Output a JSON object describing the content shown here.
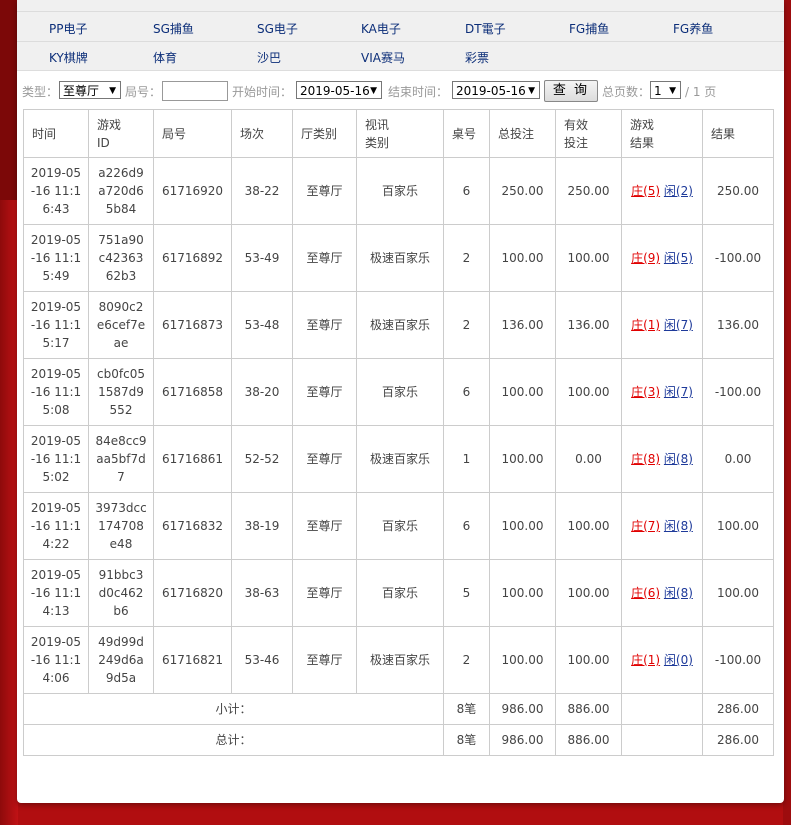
{
  "nav": {
    "row1": [
      "PP电子",
      "SG捕鱼",
      "SG电子",
      "KA电子",
      "DT電子",
      "FG捕鱼",
      "FG养鱼"
    ],
    "row2": [
      "KY棋牌",
      "体育",
      "沙巴",
      "VIA赛马",
      "彩票"
    ]
  },
  "filters": {
    "type_label": "类型：",
    "type_value": "至尊厅",
    "round_label": "局号：",
    "round_value": "",
    "start_label": "开始时间：",
    "start_value": "2019-05-16",
    "end_label": "结束时间：",
    "end_value": "2019-05-16",
    "query_button": "查 询",
    "pages_label": "总页数：",
    "page_value": "1",
    "page_total": "/ 1 页"
  },
  "table": {
    "headers": {
      "time": "时间",
      "game_id": "游戏ID",
      "round": "局号",
      "session": "场次",
      "hall_type": "厅类别",
      "video_type": "视讯类别",
      "table_no": "桌号",
      "total_bet": "总投注",
      "valid_bet": "有效投注",
      "game_result": "游戏结果",
      "result": "结果"
    },
    "rows": [
      {
        "time": "2019-05-16 11:16:43",
        "game_id": "a226d9a720d65b84",
        "round": "61716920",
        "session": "38-22",
        "hall": "至尊厅",
        "video": "百家乐",
        "table": "6",
        "total": "250.00",
        "valid": "250.00",
        "bank": "庄(5)",
        "player": "闲(2)",
        "result": "250.00"
      },
      {
        "time": "2019-05-16 11:15:49",
        "game_id": "751a90c4236362b3",
        "round": "61716892",
        "session": "53-49",
        "hall": "至尊厅",
        "video": "极速百家乐",
        "table": "2",
        "total": "100.00",
        "valid": "100.00",
        "bank": "庄(9)",
        "player": "闲(5)",
        "result": "-100.00"
      },
      {
        "time": "2019-05-16 11:15:17",
        "game_id": "8090c2e6cef7eae",
        "round": "61716873",
        "session": "53-48",
        "hall": "至尊厅",
        "video": "极速百家乐",
        "table": "2",
        "total": "136.00",
        "valid": "136.00",
        "bank": "庄(1)",
        "player": "闲(7)",
        "result": "136.00"
      },
      {
        "time": "2019-05-16 11:15:08",
        "game_id": "cb0fc051587d9552",
        "round": "61716858",
        "session": "38-20",
        "hall": "至尊厅",
        "video": "百家乐",
        "table": "6",
        "total": "100.00",
        "valid": "100.00",
        "bank": "庄(3)",
        "player": "闲(7)",
        "result": "-100.00"
      },
      {
        "time": "2019-05-16 11:15:02",
        "game_id": "84e8cc9aa5bf7d7",
        "round": "61716861",
        "session": "52-52",
        "hall": "至尊厅",
        "video": "极速百家乐",
        "table": "1",
        "total": "100.00",
        "valid": "0.00",
        "bank": "庄(8)",
        "player": "闲(8)",
        "result": "0.00"
      },
      {
        "time": "2019-05-16 11:14:22",
        "game_id": "3973dcc174708e48",
        "round": "61716832",
        "session": "38-19",
        "hall": "至尊厅",
        "video": "百家乐",
        "table": "6",
        "total": "100.00",
        "valid": "100.00",
        "bank": "庄(7)",
        "player": "闲(8)",
        "result": "100.00"
      },
      {
        "time": "2019-05-16 11:14:13",
        "game_id": "91bbc3d0c462b6",
        "round": "61716820",
        "session": "38-63",
        "hall": "至尊厅",
        "video": "百家乐",
        "table": "5",
        "total": "100.00",
        "valid": "100.00",
        "bank": "庄(6)",
        "player": "闲(8)",
        "result": "100.00"
      },
      {
        "time": "2019-05-16 11:14:06",
        "game_id": "49d99d249d6a9d5a",
        "round": "61716821",
        "session": "53-46",
        "hall": "至尊厅",
        "video": "极速百家乐",
        "table": "2",
        "total": "100.00",
        "valid": "100.00",
        "bank": "庄(1)",
        "player": "闲(0)",
        "result": "-100.00"
      }
    ],
    "subtotal": {
      "label": "小计：",
      "count": "8笔",
      "total": "986.00",
      "valid": "886.00",
      "result": "286.00"
    },
    "grandtotal": {
      "label": "总计：",
      "count": "8笔",
      "total": "986.00",
      "valid": "886.00",
      "result": "286.00"
    }
  }
}
